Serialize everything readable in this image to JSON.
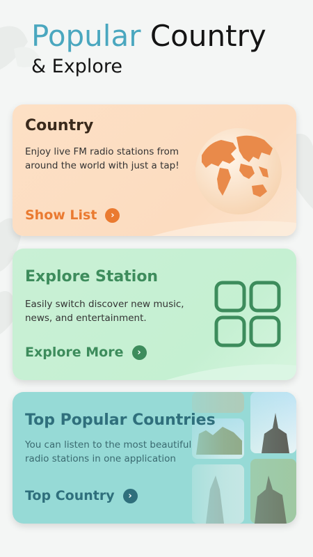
{
  "header": {
    "title_accent": "Popular",
    "title_rest": "Country",
    "subtitle": "& Explore"
  },
  "cards": [
    {
      "title": "Country",
      "description": "Enjoy live FM radio stations from around the world with just a tap!",
      "action_label": "Show List",
      "icon": "globe-icon",
      "accent": "#ea7a30"
    },
    {
      "title": "Explore Station",
      "description": "Easily switch discover new music, news, and entertainment.",
      "action_label": "Explore More",
      "icon": "grid-icon",
      "accent": "#3d8c5c"
    },
    {
      "title": "Top Popular Countries",
      "description": "You can listen to the most beautiful radio stations in one application",
      "action_label": "Top Country",
      "icon": "landmark-photos",
      "accent": "#2f6f7c"
    }
  ],
  "colors": {
    "title_accent": "#4aa7bf",
    "card1_bg": "#fde0c5",
    "card2_bg": "#c9f0d5",
    "card3_bg": "#96dad6"
  }
}
